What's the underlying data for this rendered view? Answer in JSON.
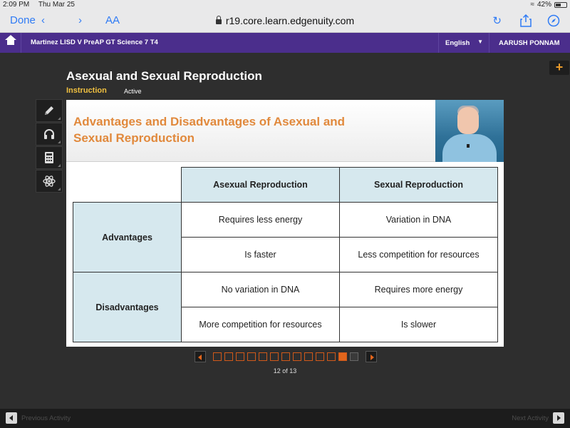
{
  "status_bar": {
    "time": "2:09 PM",
    "date": "Thu Mar 25",
    "battery": "42%"
  },
  "browser": {
    "done_label": "Done",
    "text_size_label": "AA",
    "url": "r19.core.learn.edgenuity.com"
  },
  "header": {
    "course_title": "Martinez LISD V PreAP GT Science 7 T4",
    "language": "English",
    "user_name": "AARUSH PONNAM"
  },
  "lesson": {
    "title": "Asexual and Sexual Reproduction",
    "tab": "Instruction",
    "status": "Active"
  },
  "tools": [
    "pencil-icon",
    "headphones-icon",
    "calculator-icon",
    "atom-icon"
  ],
  "slide": {
    "title": "Advantages and Disadvantages of Asexual and Sexual Reproduction",
    "table": {
      "col_headers": [
        "Asexual Reproduction",
        "Sexual Reproduction"
      ],
      "advantages_label": "Advantages",
      "disadvantages_label": "Disadvantages",
      "rows": [
        [
          "Requires less energy",
          "Variation in DNA"
        ],
        [
          "Is faster",
          "Less competition for resources"
        ],
        [
          "No variation in DNA",
          "Requires more energy"
        ],
        [
          "More competition for resources",
          "Is slower"
        ]
      ]
    }
  },
  "pager": {
    "current": 12,
    "total": 13,
    "label": "12 of 13"
  },
  "footer": {
    "previous_label": "Previous Activity",
    "next_label": "Next Activity"
  },
  "colors": {
    "header_purple": "#4b2e8c",
    "accent_orange": "#e2651c",
    "title_orange": "#e1893c",
    "table_header_blue": "#d6e8ee"
  }
}
